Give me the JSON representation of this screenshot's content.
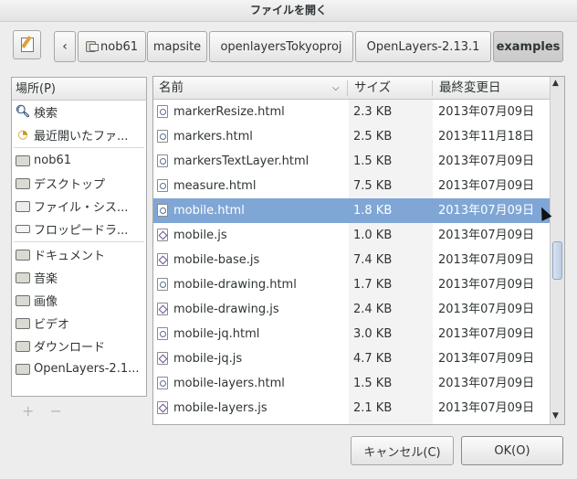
{
  "window": {
    "title": "ファイルを開く"
  },
  "breadcrumbs": [
    "nob61",
    "mapsite",
    "openlayersTokyoproj",
    "OpenLayers-2.13.1",
    "examples"
  ],
  "places": {
    "header": "場所(P)",
    "items": [
      {
        "label": "検索",
        "icon": "search-icon"
      },
      {
        "label": "最近開いたファ...",
        "icon": "recent-icon"
      },
      {
        "label": "nob61",
        "icon": "home-folder-icon"
      },
      {
        "label": "デスクトップ",
        "icon": "desktop-folder-icon"
      },
      {
        "label": "ファイル・シス...",
        "icon": "filesystem-icon"
      },
      {
        "label": "フロッピードラ...",
        "icon": "floppy-icon"
      },
      {
        "label": "ドキュメント",
        "icon": "documents-folder-icon"
      },
      {
        "label": "音楽",
        "icon": "music-folder-icon"
      },
      {
        "label": "画像",
        "icon": "pictures-folder-icon"
      },
      {
        "label": "ビデオ",
        "icon": "video-folder-icon"
      },
      {
        "label": "ダウンロード",
        "icon": "downloads-folder-icon"
      },
      {
        "label": "OpenLayers-2.1...",
        "icon": "folder-icon"
      }
    ],
    "add_symbol": "+",
    "remove_symbol": "−"
  },
  "files": {
    "columns": {
      "name": "名前",
      "size": "サイズ",
      "modified": "最終変更日"
    },
    "rows": [
      {
        "name": "markerResize.html",
        "size": "2.3 KB",
        "date": "2013年07月09日",
        "type": "html"
      },
      {
        "name": "markers.html",
        "size": "2.5 KB",
        "date": "2013年11月18日",
        "type": "html"
      },
      {
        "name": "markersTextLayer.html",
        "size": "1.5 KB",
        "date": "2013年07月09日",
        "type": "html"
      },
      {
        "name": "measure.html",
        "size": "7.5 KB",
        "date": "2013年07月09日",
        "type": "html"
      },
      {
        "name": "mobile.html",
        "size": "1.8 KB",
        "date": "2013年07月09日",
        "type": "html",
        "selected": true
      },
      {
        "name": "mobile.js",
        "size": "1.0 KB",
        "date": "2013年07月09日",
        "type": "js"
      },
      {
        "name": "mobile-base.js",
        "size": "7.4 KB",
        "date": "2013年07月09日",
        "type": "js"
      },
      {
        "name": "mobile-drawing.html",
        "size": "1.7 KB",
        "date": "2013年07月09日",
        "type": "html"
      },
      {
        "name": "mobile-drawing.js",
        "size": "2.4 KB",
        "date": "2013年07月09日",
        "type": "js"
      },
      {
        "name": "mobile-jq.html",
        "size": "3.0 KB",
        "date": "2013年07月09日",
        "type": "html"
      },
      {
        "name": "mobile-jq.js",
        "size": "4.7 KB",
        "date": "2013年07月09日",
        "type": "js"
      },
      {
        "name": "mobile-layers.html",
        "size": "1.5 KB",
        "date": "2013年07月09日",
        "type": "html"
      },
      {
        "name": "mobile-layers.js",
        "size": "2.1 KB",
        "date": "2013年07月09日",
        "type": "js"
      }
    ]
  },
  "buttons": {
    "cancel": "キャンセル(C)",
    "ok": "OK(O)"
  }
}
